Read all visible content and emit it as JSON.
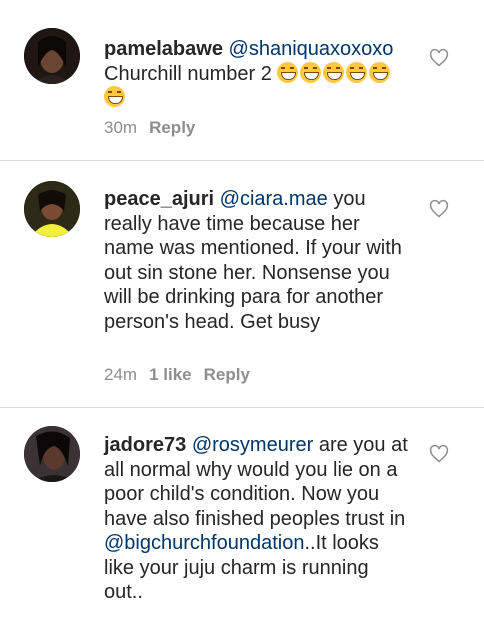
{
  "comments": [
    {
      "username": "pamelabawe",
      "mention": "@shaniquaxoxoxo",
      "text": "Churchill number 2",
      "emoji": [
        "grinning-squinting-face",
        "grinning-squinting-face",
        "grinning-squinting-face",
        "grinning-squinting-face",
        "grinning-squinting-face",
        "grinning-squinting-face"
      ],
      "time": "30m",
      "likes": "",
      "reply": "Reply"
    },
    {
      "username": "peace_ajuri",
      "mention": "@ciara.mae",
      "text": "you really have time because her name was mentioned. If your with out sin stone her. Nonsense you will be drinking para for another person's head. Get busy",
      "time": "24m",
      "likes": "1 like",
      "reply": "Reply"
    },
    {
      "username": "jadore73",
      "mention": "@rosymeurer",
      "text": "are you at all normal why would you lie on a poor child's condition. Now you have also finished peoples trust in",
      "mention2": "@bigchurchfoundation",
      "text2": "..It looks like your juju charm is running out.."
    }
  ],
  "icons": {
    "like": "heart-outline-icon",
    "avatar": "user-avatar"
  },
  "colors": {
    "mention": "#003569",
    "meta": "#8e8e8e",
    "divider": "#dbdbdb",
    "heart": "#8e8e8e"
  }
}
